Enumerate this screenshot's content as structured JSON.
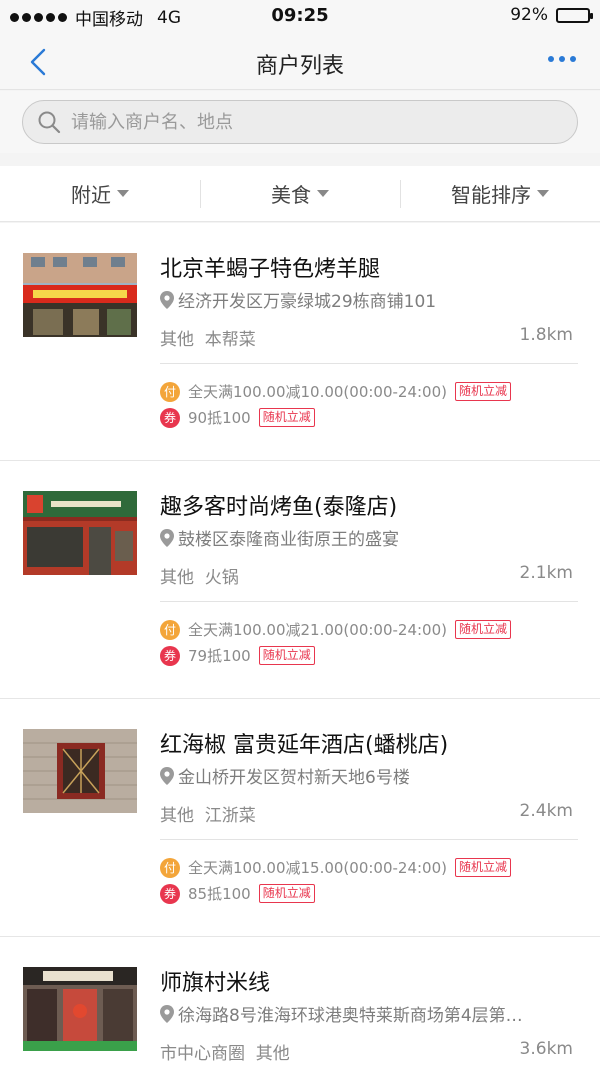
{
  "status": {
    "carrier": "中国移动",
    "network": "4G",
    "time": "09:25",
    "battery": "92%",
    "battery_level": 0.92
  },
  "nav": {
    "title": "商户列表"
  },
  "search": {
    "placeholder": "请输入商户名、地点"
  },
  "filters": [
    "附近",
    "美食",
    "智能排序"
  ],
  "merchants": [
    {
      "name": "北京羊蝎子特色烤羊腿",
      "address": "经济开发区万豪绿城29栋商铺101",
      "tags": "其他  本帮菜",
      "distance": "1.8km",
      "promo_pay": "全天满100.00减10.00(00:00-24:00)",
      "promo_coupon": "90抵100"
    },
    {
      "name": "趣多客时尚烤鱼(泰隆店)",
      "address": "鼓楼区泰隆商业街原王的盛宴",
      "tags": "其他  火锅",
      "distance": "2.1km",
      "promo_pay": "全天满100.00减21.00(00:00-24:00)",
      "promo_coupon": "79抵100"
    },
    {
      "name": "红海椒 富贵延年酒店(蟠桃店)",
      "address": "金山桥开发区贺村新天地6号楼",
      "tags": "其他  江浙菜",
      "distance": "2.4km",
      "promo_pay": "全天满100.00减15.00(00:00-24:00)",
      "promo_coupon": "85抵100"
    },
    {
      "name": "师旗村米线",
      "address": "徐海路8号淮海环球港奥特莱斯商场第4层第…",
      "tags": "市中心商圈  其他",
      "distance": "3.6km"
    }
  ],
  "labels": {
    "pay_badge": "付",
    "coupon_badge": "券",
    "random_discount": "随机立减"
  },
  "colors": {
    "accent": "#2a7ad6",
    "pay": "#f3a53a",
    "coupon": "#e8364e"
  }
}
